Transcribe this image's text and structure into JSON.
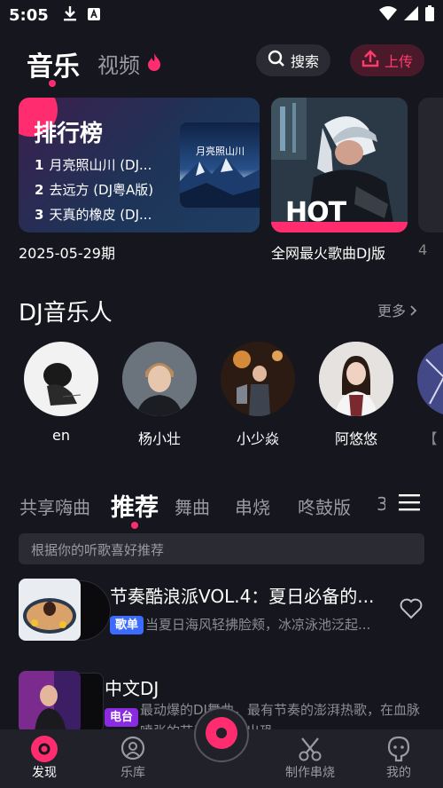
{
  "status": {
    "time": "5:05"
  },
  "header": {
    "tab_music": "音乐",
    "tab_video": "视频",
    "search_label": "搜索",
    "upload_label": "上传"
  },
  "banners": {
    "rank_title": "排行榜",
    "rank_items": [
      {
        "num": "1",
        "title": "月亮照山川 (DJ..."
      },
      {
        "num": "2",
        "title": "去远方 (DJ粤A版)"
      },
      {
        "num": "3",
        "title": "天真的橡皮 (DJ..."
      }
    ],
    "album_text": "月亮照山川",
    "hot_tag": "HOT",
    "caption_rank": "2025-05-29期",
    "caption_hot": "全网最火歌曲DJ版",
    "caption_third": "4"
  },
  "dj": {
    "title": "DJ音乐人",
    "more": "更多",
    "artists": [
      {
        "name": "en"
      },
      {
        "name": "杨小壮"
      },
      {
        "name": "小少焱"
      },
      {
        "name": "阿悠悠"
      },
      {
        "name": "【"
      }
    ]
  },
  "categories": {
    "items": [
      "共享嗨曲",
      "推荐",
      "舞曲",
      "串烧",
      "咚鼓版",
      "3"
    ],
    "active": "推荐"
  },
  "hint": "根据你的听歌喜好推荐",
  "list": [
    {
      "title": "节奏酷浪派VOL.4：夏日必备的...",
      "tag": "歌单",
      "tag_color": "#3b6cff",
      "desc": "当夏日海风轻拂脸颊，冰凉泳池泛起..."
    },
    {
      "title": "中文DJ",
      "tag": "电台",
      "tag_color": "#8a2be2",
      "desc": "最动爆的DJ舞曲，最有节奏的澎湃热歌，在血脉喷张的节奏中释放出恐"
    }
  ],
  "nav": {
    "discover": "发现",
    "library": "乐库",
    "make_mix": "制作串烧",
    "mine": "我的"
  },
  "colors": {
    "accent": "#ff2d6f",
    "bg": "#16171e"
  }
}
